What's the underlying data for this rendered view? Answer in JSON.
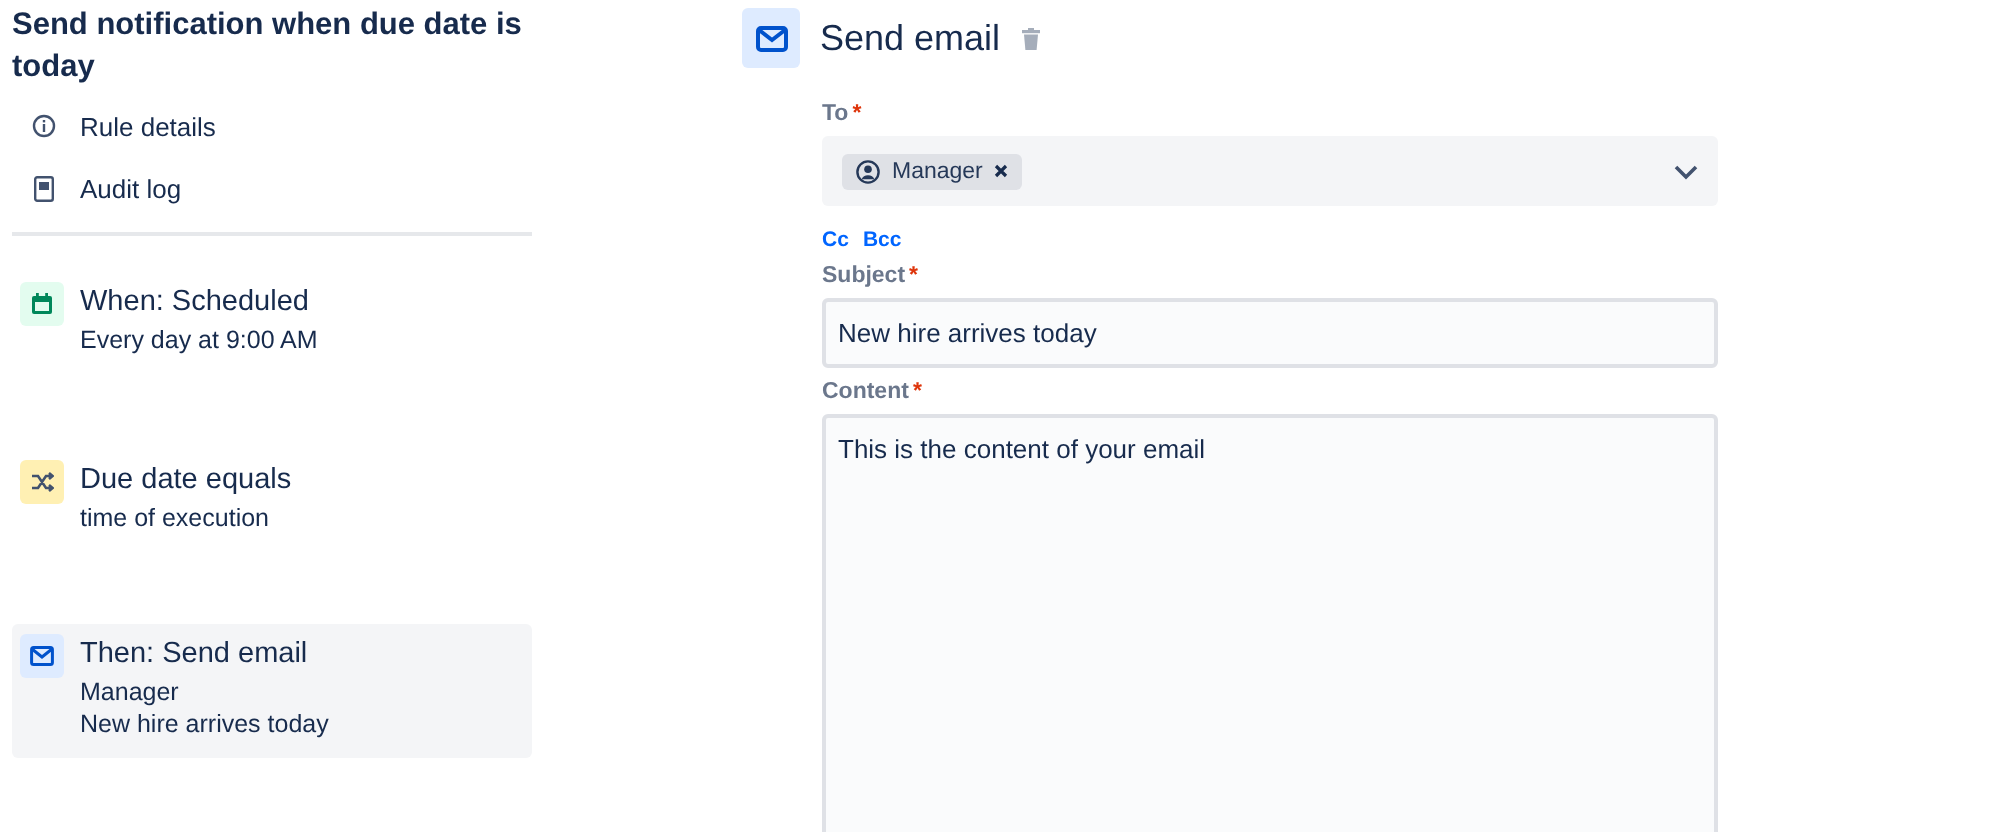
{
  "rule": {
    "title": "Send notification when due date is today"
  },
  "nav": [
    {
      "kind": "info",
      "label": "Rule details"
    },
    {
      "kind": "log",
      "label": "Audit log"
    }
  ],
  "steps": [
    {
      "kind": "trigger",
      "title": "When: Scheduled",
      "lines": [
        "Every day at 9:00 AM"
      ],
      "selected": false
    },
    {
      "kind": "condition",
      "title": "Due date equals",
      "lines": [
        "time of execution"
      ],
      "selected": false
    },
    {
      "kind": "action",
      "title": "Then: Send email",
      "lines": [
        "Manager",
        "New hire arrives today"
      ],
      "selected": true
    }
  ],
  "editor": {
    "title": "Send email",
    "fields": [
      {
        "kind": "select",
        "label": "To",
        "required_mark": "*",
        "chips": [
          "Manager"
        ],
        "links": [
          "Cc",
          "Bcc"
        ]
      },
      {
        "kind": "text",
        "label": "Subject",
        "required_mark": "*",
        "value": "New hire arrives today"
      },
      {
        "kind": "textarea",
        "label": "Content",
        "required_mark": "*",
        "value": "This is the content of your email"
      }
    ]
  }
}
